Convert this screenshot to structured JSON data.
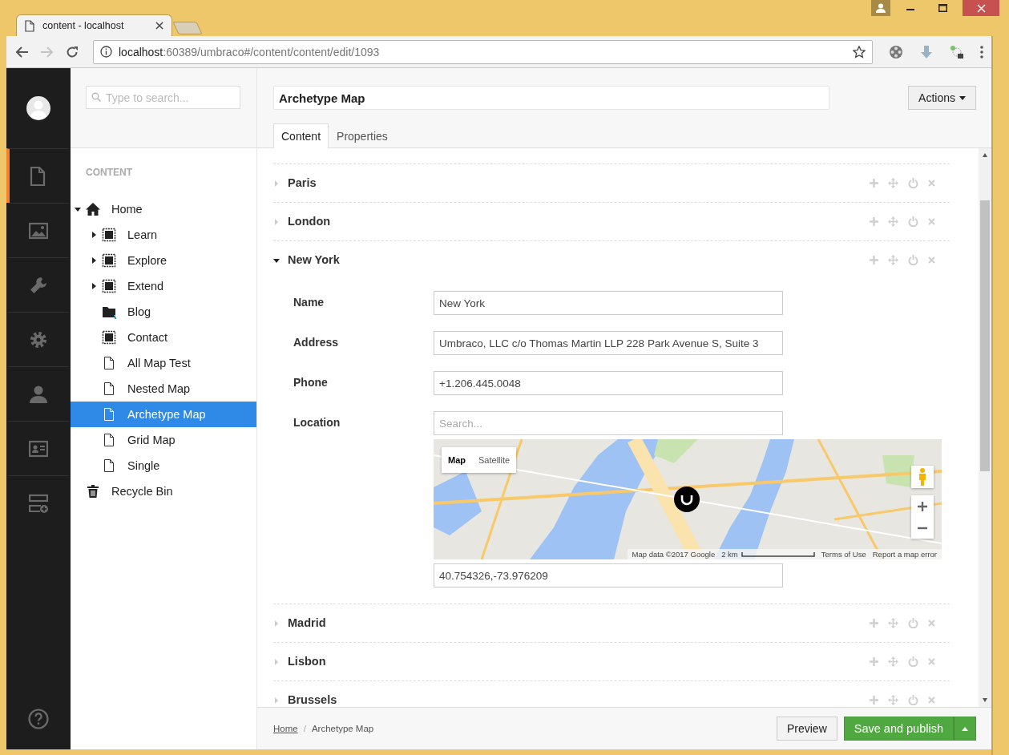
{
  "browser": {
    "tab_title": "content - localhost",
    "url_host": "localhost",
    "url_rest": ":60389/umbraco#/content/content/edit/1093"
  },
  "sections": [
    {
      "selected": true
    },
    {
      "selected": false
    },
    {
      "selected": false
    },
    {
      "selected": false
    },
    {
      "selected": false
    },
    {
      "selected": false
    },
    {
      "selected": false
    }
  ],
  "tree": {
    "search_placeholder": "Type to search...",
    "heading": "CONTENT",
    "items": [
      {
        "label": "Home",
        "kind": "home",
        "expanded": true,
        "selected": false,
        "children": [
          {
            "label": "Learn",
            "kind": "container",
            "expanded": false,
            "selected": false
          },
          {
            "label": "Explore",
            "kind": "container",
            "expanded": false,
            "selected": false
          },
          {
            "label": "Extend",
            "kind": "container",
            "expanded": false,
            "selected": false
          },
          {
            "label": "Blog",
            "kind": "folder",
            "selected": false
          },
          {
            "label": "Contact",
            "kind": "container",
            "selected": false
          },
          {
            "label": "All Map Test",
            "kind": "doc",
            "selected": false
          },
          {
            "label": "Nested Map",
            "kind": "doc",
            "selected": false
          },
          {
            "label": "Archetype Map",
            "kind": "doc",
            "selected": true
          },
          {
            "label": "Grid Map",
            "kind": "doc",
            "selected": false
          },
          {
            "label": "Single",
            "kind": "doc",
            "selected": false
          }
        ]
      },
      {
        "label": "Recycle Bin",
        "kind": "bin",
        "selected": false
      }
    ]
  },
  "editor": {
    "name": "Archetype Map",
    "actions": "Actions",
    "tabs": [
      {
        "label": "Content",
        "selected": true
      },
      {
        "label": "Properties",
        "selected": false
      }
    ],
    "items": [
      {
        "title": "Paris",
        "expanded": false
      },
      {
        "title": "London",
        "expanded": false
      },
      {
        "title": "New York",
        "expanded": true,
        "fields": [
          {
            "kind": "text",
            "label": "Name",
            "value": "New York"
          },
          {
            "kind": "text",
            "label": "Address",
            "value": "Umbraco, LLC c/o Thomas Martin LLP 228 Park Avenue S, Suite 3"
          },
          {
            "kind": "text",
            "label": "Phone",
            "value": "+1.206.445.0048"
          },
          {
            "kind": "map",
            "label": "Location",
            "search_placeholder": "Search...",
            "map_types": [
              {
                "label": "Map",
                "selected": true
              },
              {
                "label": "Satellite",
                "selected": false
              }
            ],
            "attribution": "Map data ©2017 Google",
            "scale": "2 km",
            "terms": "Terms of Use",
            "report": "Report a map error",
            "value": "40.754326,-73.976209"
          }
        ]
      },
      {
        "title": "Madrid",
        "expanded": false
      },
      {
        "title": "Lisbon",
        "expanded": false
      },
      {
        "title": "Brussels",
        "expanded": false
      }
    ]
  },
  "footer": {
    "separator": "/",
    "breadcrumb": [
      {
        "label": "Home",
        "kind": "link"
      },
      {
        "label": "Archetype Map",
        "kind": "current"
      }
    ],
    "preview": "Preview",
    "save": "Save and publish"
  }
}
